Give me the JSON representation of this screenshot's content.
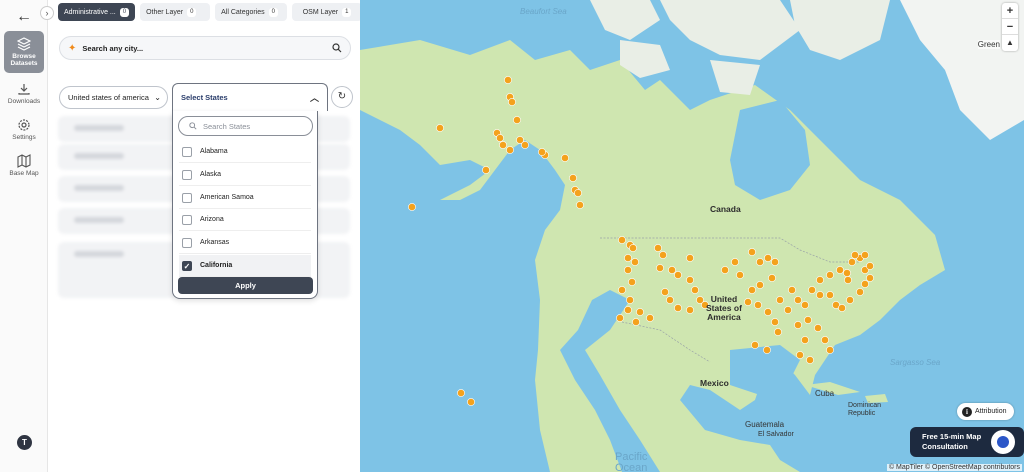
{
  "rail": {
    "back_icon": "arrow-left-icon",
    "items": [
      {
        "label": "Browse\nDatasets",
        "icon": "layers-icon"
      },
      {
        "label": "Downloads",
        "icon": "download-icon"
      },
      {
        "label": "Settings",
        "icon": "gear-icon"
      },
      {
        "label": "Base Map",
        "icon": "map-icon"
      }
    ],
    "avatar_initial": "T"
  },
  "tabs": [
    {
      "label": "Administrative ...",
      "count": "0"
    },
    {
      "label": "Other Layer",
      "count": "0"
    },
    {
      "label": "All Categories",
      "count": "0"
    },
    {
      "label": "OSM Layer",
      "count": "1"
    }
  ],
  "search": {
    "placeholder": "Search any city..."
  },
  "filters": {
    "country": "United states of america",
    "states_placeholder": "Select States",
    "states_search_placeholder": "Search States",
    "options": [
      {
        "label": "Alabama",
        "checked": false
      },
      {
        "label": "Alaska",
        "checked": false
      },
      {
        "label": "American Samoa",
        "checked": false
      },
      {
        "label": "Arizona",
        "checked": false
      },
      {
        "label": "Arkansas",
        "checked": false
      },
      {
        "label": "California",
        "checked": true
      }
    ],
    "apply_label": "Apply"
  },
  "map": {
    "labels": {
      "canada": "Canada",
      "usa": "United\nStates of\nAmerica",
      "mexico": "Mexico",
      "cuba": "Cuba",
      "guatemala": "Guatemala",
      "el_salvador": "El Salvador",
      "dominican": "Dominican\nRepublic",
      "beaufort": "Beaufort Sea",
      "sargasso": "Sargasso Sea",
      "pacific": "Pacific\nOcean",
      "greenland": "Green"
    },
    "zoom_in": "+",
    "zoom_out": "−",
    "compass": "▲",
    "attribution_label": "Attribution",
    "consult": "Free 15-min Map\nConsultation",
    "credits": "© MapTiler © OpenStreetMap contributors",
    "marker_color": "#f4a21d",
    "land_color": "#cfe6b0",
    "water_color": "#7ec3e6"
  }
}
